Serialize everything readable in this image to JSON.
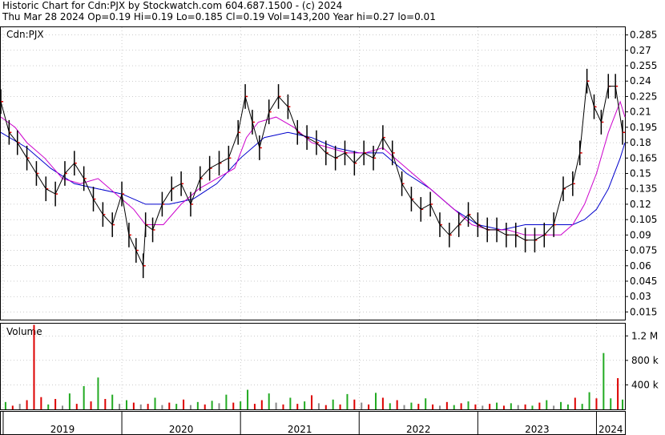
{
  "header": {
    "line1": "Historic Chart for Cdn:PJX by Stockwatch.com 604.687.1500 - (c) 2024",
    "line2": "Thu Mar 28 2024   Op=0.19   Hi=0.19   Lo=0.185   Cl=0.19   Vol=143,200   Year hi=0.27   lo=0.01"
  },
  "price_panel": {
    "label": "Cdn:PJX"
  },
  "volume_panel": {
    "label": "Volume"
  },
  "colors": {
    "price_bar": "#000000",
    "ma_short": "#cc00cc",
    "ma_long": "#0000cc",
    "volume_up": "#22aa22",
    "volume_down": "#dd0000",
    "volume_flat": "#888888",
    "close_tick": "#dd0000",
    "grid": "#999999"
  },
  "chart_data": {
    "type": "line",
    "title": "Historic Chart for Cdn:PJX",
    "x_axis_labels": [
      "2019",
      "2020",
      "2021",
      "2022",
      "2023",
      "2024"
    ],
    "y_axis_labels": [
      "0.285",
      "0.27",
      "0.255",
      "0.24",
      "0.225",
      "0.21",
      "0.195",
      "0.18",
      "0.165",
      "0.15",
      "0.135",
      "0.12",
      "0.105",
      "0.09",
      "0.075",
      "0.06",
      "0.045",
      "0.03",
      "0.015"
    ],
    "ylim": [
      0.0075,
      0.2925
    ],
    "volume_axis_labels": [
      "1.2 M",
      "800 k",
      "400 k"
    ],
    "volume_ylim": [
      0,
      1400000
    ],
    "xlim": [
      2018.98,
      2024.24
    ],
    "series": [
      {
        "name": "Price",
        "x": [
          2018.98,
          2019.05,
          2019.12,
          2019.2,
          2019.28,
          2019.36,
          2019.44,
          2019.52,
          2019.6,
          2019.68,
          2019.76,
          2019.84,
          2019.92,
          2020.0,
          2020.06,
          2020.12,
          2020.18,
          2020.2,
          2020.26,
          2020.34,
          2020.42,
          2020.5,
          2020.58,
          2020.66,
          2020.74,
          2020.82,
          2020.9,
          2020.98,
          2021.04,
          2021.1,
          2021.16,
          2021.24,
          2021.32,
          2021.4,
          2021.48,
          2021.56,
          2021.64,
          2021.72,
          2021.8,
          2021.88,
          2021.96,
          2022.04,
          2022.12,
          2022.2,
          2022.28,
          2022.36,
          2022.44,
          2022.52,
          2022.6,
          2022.68,
          2022.76,
          2022.84,
          2022.92,
          2023.0,
          2023.08,
          2023.16,
          2023.24,
          2023.32,
          2023.4,
          2023.48,
          2023.56,
          2023.64,
          2023.72,
          2023.8,
          2023.86,
          2023.92,
          2023.98,
          2024.04,
          2024.1,
          2024.16,
          2024.22
        ],
        "values": [
          0.22,
          0.19,
          0.18,
          0.165,
          0.15,
          0.135,
          0.13,
          0.15,
          0.16,
          0.145,
          0.125,
          0.11,
          0.1,
          0.13,
          0.09,
          0.075,
          0.06,
          0.1,
          0.095,
          0.12,
          0.135,
          0.14,
          0.12,
          0.145,
          0.155,
          0.16,
          0.165,
          0.19,
          0.225,
          0.2,
          0.175,
          0.21,
          0.225,
          0.215,
          0.19,
          0.185,
          0.18,
          0.17,
          0.165,
          0.17,
          0.16,
          0.17,
          0.165,
          0.185,
          0.17,
          0.14,
          0.125,
          0.115,
          0.12,
          0.1,
          0.09,
          0.1,
          0.11,
          0.1,
          0.095,
          0.095,
          0.09,
          0.09,
          0.085,
          0.085,
          0.09,
          0.1,
          0.135,
          0.14,
          0.17,
          0.24,
          0.215,
          0.2,
          0.235,
          0.235,
          0.19
        ]
      },
      {
        "name": "MA short",
        "x": [
          2018.98,
          2019.1,
          2019.2,
          2019.35,
          2019.5,
          2019.65,
          2019.8,
          2019.95,
          2020.1,
          2020.2,
          2020.35,
          2020.5,
          2020.65,
          2020.8,
          2020.95,
          2021.05,
          2021.15,
          2021.3,
          2021.45,
          2021.6,
          2021.75,
          2021.9,
          2022.05,
          2022.2,
          2022.35,
          2022.5,
          2022.65,
          2022.8,
          2022.95,
          2023.1,
          2023.25,
          2023.4,
          2023.55,
          2023.7,
          2023.8,
          2023.9,
          2024.0,
          2024.1,
          2024.2,
          2024.24
        ],
        "values": [
          0.205,
          0.195,
          0.18,
          0.165,
          0.145,
          0.14,
          0.145,
          0.13,
          0.115,
          0.1,
          0.1,
          0.12,
          0.135,
          0.145,
          0.155,
          0.185,
          0.2,
          0.205,
          0.195,
          0.18,
          0.175,
          0.17,
          0.17,
          0.175,
          0.16,
          0.145,
          0.13,
          0.115,
          0.1,
          0.095,
          0.095,
          0.09,
          0.09,
          0.09,
          0.1,
          0.12,
          0.15,
          0.19,
          0.22,
          0.205
        ]
      },
      {
        "name": "MA long",
        "x": [
          2018.98,
          2019.2,
          2019.4,
          2019.6,
          2019.8,
          2020.0,
          2020.2,
          2020.4,
          2020.6,
          2020.8,
          2021.0,
          2021.2,
          2021.4,
          2021.6,
          2021.8,
          2022.0,
          2022.2,
          2022.4,
          2022.6,
          2022.8,
          2023.0,
          2023.2,
          2023.4,
          2023.6,
          2023.7,
          2023.8,
          2023.9,
          2024.0,
          2024.1,
          2024.2,
          2024.24
        ],
        "values": [
          0.19,
          0.175,
          0.155,
          0.14,
          0.135,
          0.13,
          0.12,
          0.12,
          0.125,
          0.14,
          0.165,
          0.185,
          0.19,
          0.185,
          0.175,
          0.17,
          0.17,
          0.15,
          0.135,
          0.115,
          0.1,
          0.095,
          0.1,
          0.1,
          0.1,
          0.1,
          0.105,
          0.115,
          0.135,
          0.165,
          0.18
        ]
      }
    ],
    "volume": {
      "x": [
        2019.02,
        2019.08,
        2019.14,
        2019.2,
        2019.26,
        2019.32,
        2019.38,
        2019.44,
        2019.5,
        2019.56,
        2019.62,
        2019.68,
        2019.74,
        2019.8,
        2019.86,
        2019.92,
        2019.98,
        2020.04,
        2020.1,
        2020.16,
        2020.22,
        2020.28,
        2020.34,
        2020.4,
        2020.46,
        2020.52,
        2020.58,
        2020.64,
        2020.7,
        2020.76,
        2020.82,
        2020.88,
        2020.94,
        2021.0,
        2021.06,
        2021.12,
        2021.18,
        2021.24,
        2021.3,
        2021.36,
        2021.42,
        2021.48,
        2021.54,
        2021.6,
        2021.66,
        2021.72,
        2021.78,
        2021.84,
        2021.9,
        2021.96,
        2022.02,
        2022.08,
        2022.14,
        2022.2,
        2022.26,
        2022.32,
        2022.38,
        2022.44,
        2022.5,
        2022.56,
        2022.62,
        2022.68,
        2022.74,
        2022.8,
        2022.86,
        2022.92,
        2022.98,
        2023.04,
        2023.1,
        2023.16,
        2023.22,
        2023.28,
        2023.34,
        2023.4,
        2023.46,
        2023.52,
        2023.58,
        2023.64,
        2023.7,
        2023.76,
        2023.82,
        2023.88,
        2023.94,
        2024.0,
        2024.06,
        2024.12,
        2024.18,
        2024.22
      ],
      "values": [
        120000,
        60000,
        90000,
        150000,
        1380000,
        200000,
        80000,
        170000,
        60000,
        260000,
        90000,
        380000,
        130000,
        520000,
        170000,
        240000,
        90000,
        150000,
        110000,
        80000,
        90000,
        190000,
        70000,
        110000,
        90000,
        160000,
        70000,
        120000,
        80000,
        140000,
        100000,
        240000,
        110000,
        130000,
        320000,
        90000,
        150000,
        260000,
        110000,
        80000,
        190000,
        90000,
        130000,
        230000,
        100000,
        70000,
        160000,
        80000,
        250000,
        160000,
        110000,
        80000,
        270000,
        190000,
        100000,
        150000,
        70000,
        110000,
        90000,
        180000,
        80000,
        60000,
        120000,
        70000,
        100000,
        130000,
        80000,
        60000,
        90000,
        110000,
        60000,
        100000,
        70000,
        80000,
        60000,
        110000,
        150000,
        60000,
        120000,
        80000,
        190000,
        90000,
        280000,
        180000,
        920000,
        180000,
        510000,
        160000
      ],
      "direction": [
        "up",
        "down",
        "flat",
        "down",
        "down",
        "down",
        "up",
        "down",
        "flat",
        "up",
        "down",
        "up",
        "down",
        "up",
        "down",
        "up",
        "flat",
        "up",
        "down",
        "flat",
        "down",
        "up",
        "flat",
        "down",
        "up",
        "down",
        "flat",
        "up",
        "down",
        "up",
        "flat",
        "up",
        "down",
        "up",
        "up",
        "down",
        "down",
        "up",
        "flat",
        "down",
        "up",
        "down",
        "up",
        "down",
        "flat",
        "down",
        "up",
        "down",
        "up",
        "down",
        "flat",
        "down",
        "up",
        "down",
        "up",
        "down",
        "flat",
        "up",
        "down",
        "up",
        "down",
        "flat",
        "down",
        "up",
        "down",
        "up",
        "down",
        "flat",
        "down",
        "up",
        "down",
        "up",
        "flat",
        "down",
        "up",
        "down",
        "up",
        "flat",
        "up",
        "up",
        "down",
        "up",
        "up",
        "down",
        "up",
        "up",
        "down",
        "up"
      ]
    }
  }
}
